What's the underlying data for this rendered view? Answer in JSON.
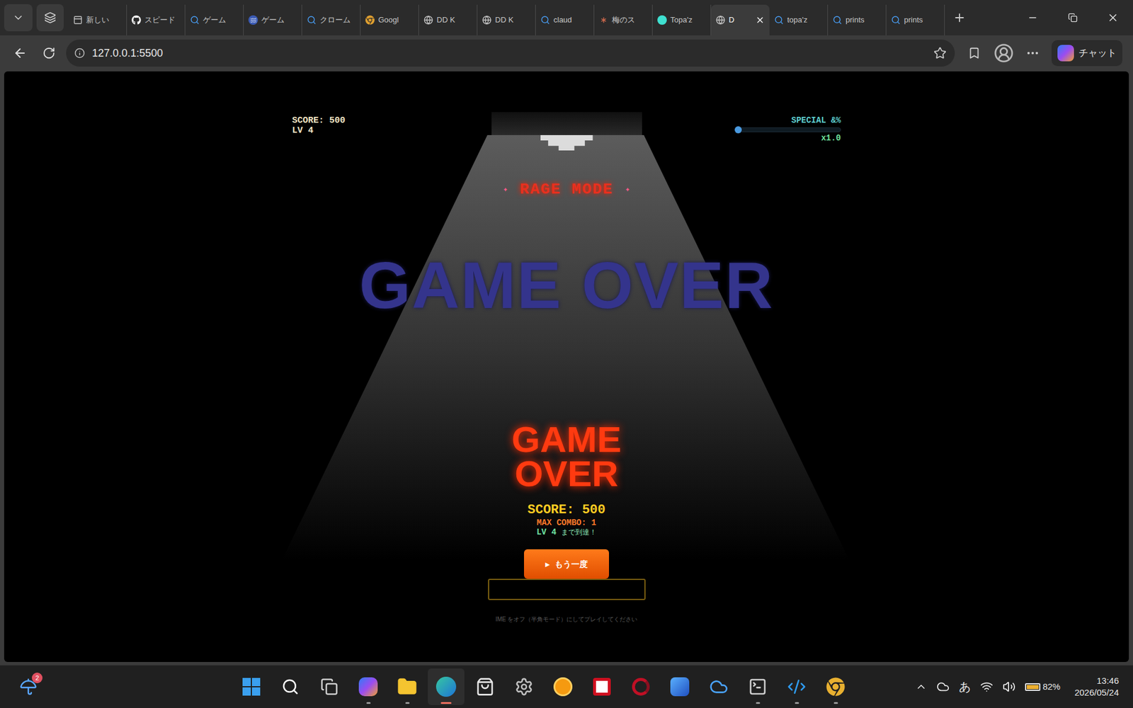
{
  "browser": {
    "tabs": [
      {
        "label": "新しい",
        "kind": "page",
        "selected": false
      },
      {
        "label": "スピード",
        "kind": "github",
        "selected": false
      },
      {
        "label": "ゲーム",
        "kind": "search",
        "selected": false
      },
      {
        "label": "ゲーム",
        "kind": "wave",
        "selected": false
      },
      {
        "label": "クローム",
        "kind": "search",
        "selected": false
      },
      {
        "label": "Googl",
        "kind": "chrome",
        "selected": false
      },
      {
        "label": "DD K",
        "kind": "globe",
        "selected": false
      },
      {
        "label": "DD K",
        "kind": "globe",
        "selected": false
      },
      {
        "label": "claud",
        "kind": "search",
        "selected": false
      },
      {
        "label": "梅のス",
        "kind": "claude",
        "selected": false
      },
      {
        "label": "Topa'z",
        "kind": "topaz",
        "selected": false
      },
      {
        "label": "D",
        "kind": "globe",
        "selected": true
      },
      {
        "label": "topa'z",
        "kind": "search",
        "selected": false
      },
      {
        "label": "prints",
        "kind": "search",
        "selected": false
      },
      {
        "label": "prints",
        "kind": "search",
        "selected": false
      }
    ],
    "url": "127.0.0.1:5500",
    "chat_button": "チャット"
  },
  "game": {
    "hud": {
      "score": "SCORE: 500",
      "level": "LV 4",
      "special_label": "SPECIAL &%",
      "special_level": 0.02,
      "multiplier": "x1.0"
    },
    "mode_banner": {
      "left": "✦",
      "text": "RAGE MODE",
      "right": "✦"
    },
    "backdrop_title": "GAME OVER",
    "title_lines": [
      "GAME",
      "OVER"
    ],
    "final_score": "SCORE: 500",
    "max_combo": "MAX COMBO: 1",
    "reached_level": "LV 4",
    "reached_suffix": "まで到達！",
    "retry_button": {
      "icon": "▶",
      "label": "もう一度"
    },
    "name_input": {
      "value": ""
    },
    "hint": "IME をオフ（半角モード）にしてプレイしてください"
  },
  "taskbar": {
    "weather_badge": "2",
    "apps": [
      {
        "kind": "start",
        "running": false,
        "selected": false
      },
      {
        "kind": "search",
        "running": false,
        "selected": false
      },
      {
        "kind": "taskview",
        "running": false,
        "selected": false
      },
      {
        "kind": "copilot",
        "running": true,
        "selected": false
      },
      {
        "kind": "explorer",
        "running": true,
        "selected": false
      },
      {
        "kind": "edge",
        "running": true,
        "selected": true
      },
      {
        "kind": "store",
        "running": false,
        "selected": false
      },
      {
        "kind": "settings",
        "running": false,
        "selected": false
      },
      {
        "kind": "coin",
        "running": false,
        "selected": false
      },
      {
        "kind": "rakuten",
        "running": false,
        "selected": false
      },
      {
        "kind": "rakuten2",
        "running": false,
        "selected": false
      },
      {
        "kind": "preview",
        "running": false,
        "selected": false
      },
      {
        "kind": "cloud",
        "running": false,
        "selected": false
      },
      {
        "kind": "terminal",
        "running": true,
        "selected": false
      },
      {
        "kind": "vscode",
        "running": true,
        "selected": false
      },
      {
        "kind": "chrome",
        "running": true,
        "selected": false
      }
    ],
    "ime": "あ",
    "battery": "82%",
    "time": "13:46",
    "date": "2026/05/24"
  }
}
